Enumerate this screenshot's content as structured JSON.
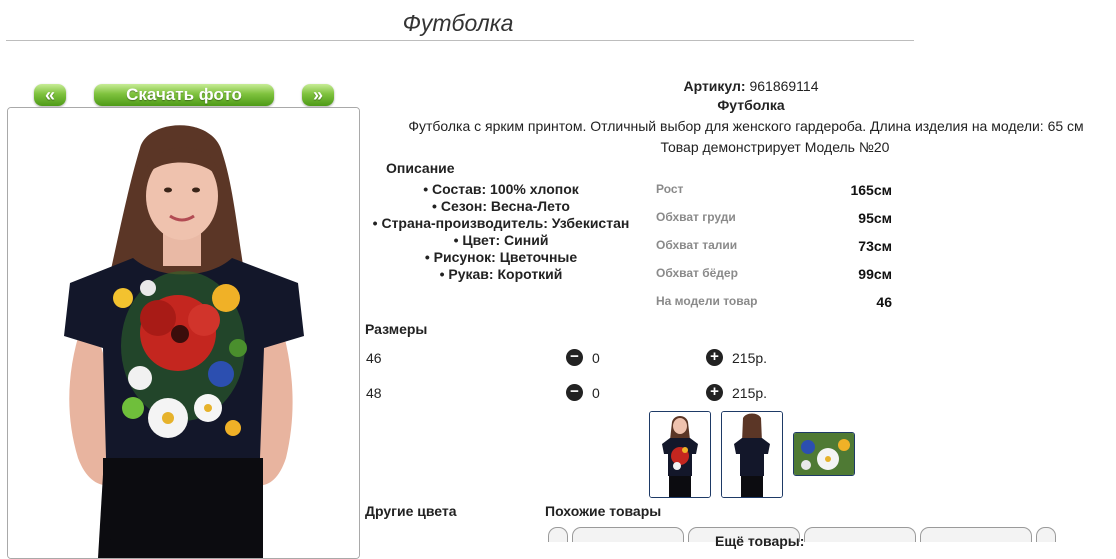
{
  "header": {
    "title": "Футболка"
  },
  "gallery": {
    "prev_label": "«",
    "next_label": "»",
    "download_label": "Скачать фото"
  },
  "product": {
    "article_label": "Артикул:",
    "article_value": "961869114",
    "name": "Футболка",
    "description": "Футболка с ярким принтом. Отличный выбор для женского гардероба. Длина изделия на модели: 65 см",
    "model_note": "Товар демонстрирует Модель №20"
  },
  "details": {
    "title": "Описание",
    "properties": [
      "Состав: 100% хлопок",
      "Сезон: Весна-Лето",
      "Страна-производитель: Узбекистан",
      "Цвет: Синий",
      "Рисунок: Цветочные",
      "Рукав: Короткий"
    ]
  },
  "measurements": [
    {
      "label": "Рост",
      "value": "165см"
    },
    {
      "label": "Обхват груди",
      "value": "95см"
    },
    {
      "label": "Обхват талии",
      "value": "73см"
    },
    {
      "label": "Обхват бёдер",
      "value": "99см"
    },
    {
      "label": "На модели товар",
      "value": "46"
    }
  ],
  "sizes": {
    "title": "Размеры",
    "rows": [
      {
        "size": "46",
        "minus_icon": "minus-circle-icon",
        "qty": "0",
        "plus_icon": "plus-circle-icon",
        "price": "215р."
      },
      {
        "size": "48",
        "minus_icon": "minus-circle-icon",
        "qty": "0",
        "plus_icon": "plus-circle-icon",
        "price": "215р."
      }
    ]
  },
  "thumbnails": [
    "front-view",
    "back-view",
    "print-detail"
  ],
  "other_colors": {
    "title": "Другие цвета"
  },
  "similar": {
    "title": "Похожие товары",
    "more_label": "Ещё товары:"
  },
  "colors": {
    "shirt": "#13172a",
    "button_green": "#5aa51f",
    "thumb_border": "#1e3a66"
  }
}
